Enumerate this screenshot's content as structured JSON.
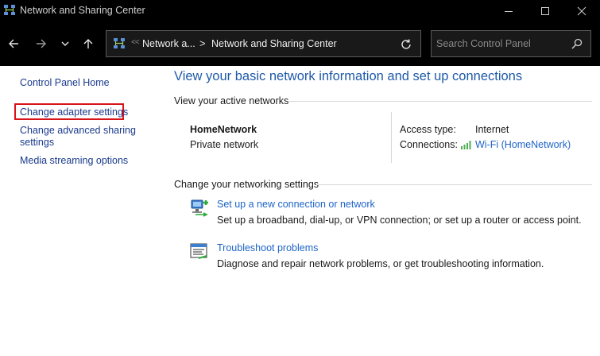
{
  "window": {
    "title": "Network and Sharing Center"
  },
  "address_bar": {
    "overflow_chevrons": "<<",
    "crumbs": [
      "Network a...",
      "Network and Sharing Center"
    ],
    "separator": ">"
  },
  "search": {
    "placeholder": "Search Control Panel"
  },
  "sidebar": {
    "items": [
      {
        "label": "Control Panel Home"
      },
      {
        "label": "Change adapter settings"
      },
      {
        "label": "Change advanced sharing\nsettings",
        "line1": "Change advanced sharing",
        "line2": "settings"
      },
      {
        "label": "Media streaming options"
      }
    ]
  },
  "main": {
    "heading": "View your basic network information and set up connections",
    "active_networks_label": "View your active networks",
    "network": {
      "name": "HomeNetwork",
      "type": "Private network",
      "access_type_label": "Access type:",
      "access_type_value": "Internet",
      "connections_label": "Connections:",
      "connections_value": "Wi-Fi (HomeNetwork)"
    },
    "change_settings_label": "Change your networking settings",
    "tasks": [
      {
        "icon": "new-connection-icon",
        "title": "Set up a new connection or network",
        "description": "Set up a broadband, dial-up, or VPN connection; or set up a router or access point."
      },
      {
        "icon": "troubleshoot-icon",
        "title": "Troubleshoot problems",
        "description": "Diagnose and repair network problems, or get troubleshooting information."
      }
    ]
  },
  "colors": {
    "link": "#1e64c8",
    "heading": "#1e5aa8",
    "highlight": "#d7141a",
    "chrome": "#000000"
  }
}
